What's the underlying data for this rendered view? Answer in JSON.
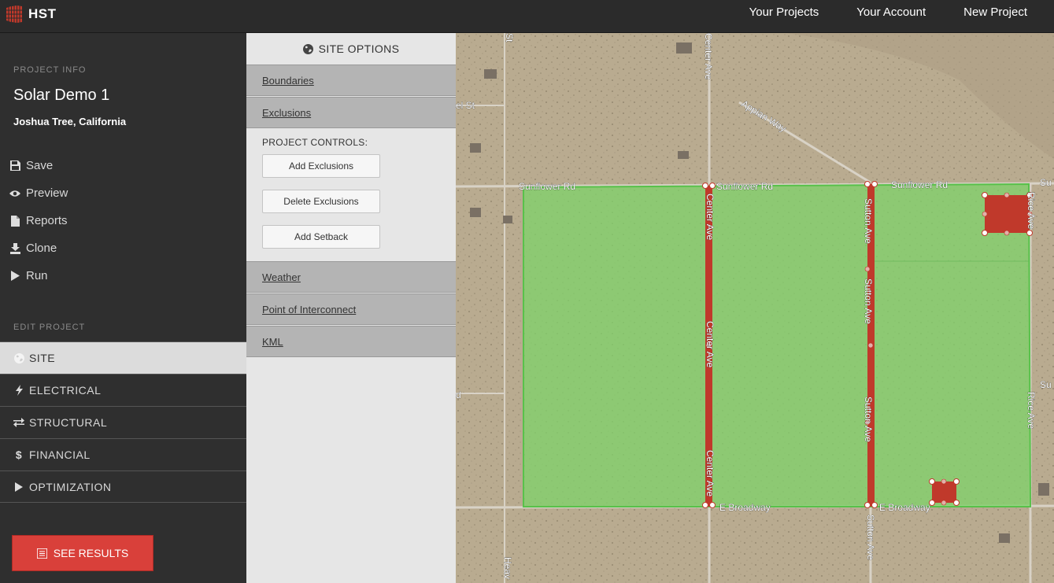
{
  "app": {
    "logo_text": "HST",
    "nav": [
      "Your Projects",
      "Your Account",
      "New Project"
    ]
  },
  "sidebar": {
    "project_info_label": "PROJECT INFO",
    "project_name": "Solar Demo 1",
    "project_location": "Joshua Tree, California",
    "actions": [
      {
        "label": "Save",
        "icon": "save-icon"
      },
      {
        "label": "Preview",
        "icon": "eye-icon"
      },
      {
        "label": "Reports",
        "icon": "document-icon"
      },
      {
        "label": "Clone",
        "icon": "clone-icon"
      },
      {
        "label": "Run",
        "icon": "play-icon"
      }
    ],
    "edit_project_label": "EDIT PROJECT",
    "edit_items": [
      {
        "label": "SITE",
        "icon": "globe-icon",
        "active": true
      },
      {
        "label": "ELECTRICAL",
        "icon": "lightning-icon",
        "active": false
      },
      {
        "label": "STRUCTURAL",
        "icon": "arrows-icon",
        "active": false
      },
      {
        "label": "FINANCIAL",
        "icon": "dollar-icon",
        "active": false
      },
      {
        "label": "OPTIMIZATION",
        "icon": "play-icon",
        "active": false
      }
    ],
    "see_results": "SEE RESULTS"
  },
  "options": {
    "header": "SITE OPTIONS",
    "sections_top": [
      "Boundaries",
      "Exclusions"
    ],
    "controls_label": "PROJECT CONTROLS:",
    "buttons": [
      "Add Exclusions",
      "Delete Exclusions",
      "Add Setback"
    ],
    "sections_bottom": [
      "Weather",
      "Point of Interconnect",
      "KML"
    ]
  },
  "map": {
    "road_labels": [
      "Sunflower Rd",
      "Sunflower Rd",
      "Sunflower Rd",
      "Center Ave",
      "Center Ave",
      "Center Ave",
      "Center Ave",
      "Appian Way",
      "Sutton Ave",
      "Sutton Ave",
      "Sutton Ave",
      "Sutton Ave",
      "Rice Ave",
      "Rice Ave",
      "E Broadway",
      "E Broadway",
      "el St",
      "Heav",
      "Su",
      "Su",
      "d",
      "St"
    ],
    "colors": {
      "boundary": "#7fd36a",
      "exclusion": "#c0392b",
      "terrain": "#b7a98e"
    }
  }
}
